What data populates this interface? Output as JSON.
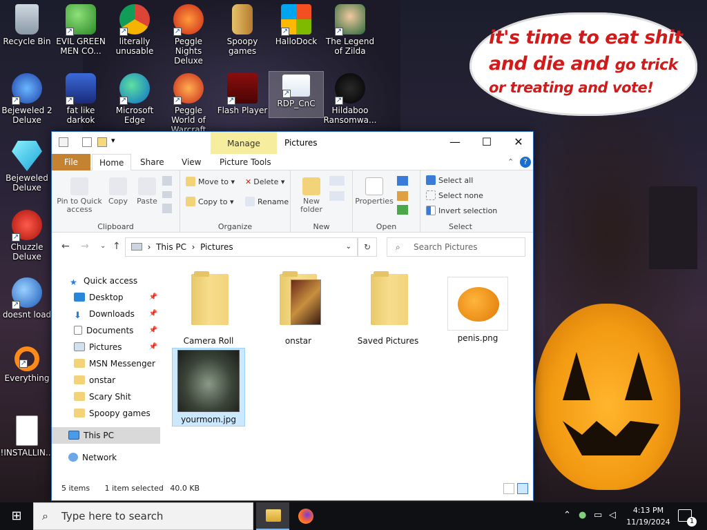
{
  "desktop": {
    "icons": [
      {
        "label": "Recycle Bin"
      },
      {
        "label": "EVIL GREEN MEN CO..."
      },
      {
        "label": "literally unusable"
      },
      {
        "label": "Peggle Nights Deluxe"
      },
      {
        "label": "Spoopy games"
      },
      {
        "label": "HalloDock"
      },
      {
        "label": "The Legend of Zilda"
      },
      {
        "label": "Bejeweled 2 Deluxe"
      },
      {
        "label": "fat like darkok"
      },
      {
        "label": "Microsoft Edge"
      },
      {
        "label": "Peggle World of Warcraft"
      },
      {
        "label": "Flash Player"
      },
      {
        "label": "RDP_CnC"
      },
      {
        "label": "Hildaboo Ransomwa..."
      },
      {
        "label": "Bejeweled Deluxe"
      },
      {
        "label": "Chuzzle Deluxe"
      },
      {
        "label": "doesnt load"
      },
      {
        "label": "Everything"
      },
      {
        "label": "!INSTALLIN..."
      }
    ],
    "speech_bubble": {
      "line1": "it's time to eat shit",
      "line2a": "and die and",
      "line2b": "go trick",
      "line3": "or treating and vote!"
    },
    "bubble_color": "#d11a1a"
  },
  "explorer": {
    "title": "Pictures",
    "contextual_tab": "Manage",
    "window_controls": {
      "minimize": "—",
      "maximize": "☐",
      "close": "✕"
    },
    "tabs": [
      "File",
      "Home",
      "Share",
      "View",
      "Picture Tools"
    ],
    "ribbon": {
      "clipboard": {
        "label": "Clipboard",
        "pin": "Pin to Quick access",
        "copy": "Copy",
        "paste": "Paste"
      },
      "organize": {
        "label": "Organize",
        "move_to": "Move to",
        "copy_to": "Copy to",
        "delete": "Delete",
        "rename": "Rename"
      },
      "new": {
        "label": "New",
        "new_folder": "New folder"
      },
      "open": {
        "label": "Open",
        "properties": "Properties"
      },
      "select": {
        "label": "Select",
        "select_all": "Select all",
        "select_none": "Select none",
        "invert": "Invert selection"
      }
    },
    "address": {
      "segments": [
        "This PC",
        "Pictures"
      ],
      "search_placeholder": "Search Pictures"
    },
    "nav": {
      "quick_access": "Quick access",
      "items": [
        {
          "label": "Desktop",
          "pinned": true
        },
        {
          "label": "Downloads",
          "pinned": true
        },
        {
          "label": "Documents",
          "pinned": true
        },
        {
          "label": "Pictures",
          "pinned": true
        },
        {
          "label": "MSN Messenger",
          "pinned": false
        },
        {
          "label": "onstar",
          "pinned": false
        },
        {
          "label": "Scary Shit",
          "pinned": false
        },
        {
          "label": "Spoopy games",
          "pinned": false
        }
      ],
      "this_pc": "This PC",
      "network": "Network"
    },
    "files": [
      {
        "name": "Camera Roll",
        "type": "folder"
      },
      {
        "name": "onstar",
        "type": "folder"
      },
      {
        "name": "Saved Pictures",
        "type": "folder"
      },
      {
        "name": "penis.png",
        "type": "image"
      },
      {
        "name": "yourmom.jpg",
        "type": "image",
        "selected": true
      }
    ],
    "status": {
      "items": "5 items",
      "selected": "1 item selected",
      "size": "40.0 KB"
    }
  },
  "taskbar": {
    "search_placeholder": "Type here to search",
    "time": "4:13 PM",
    "date": "11/19/2024",
    "notification_count": "1"
  }
}
